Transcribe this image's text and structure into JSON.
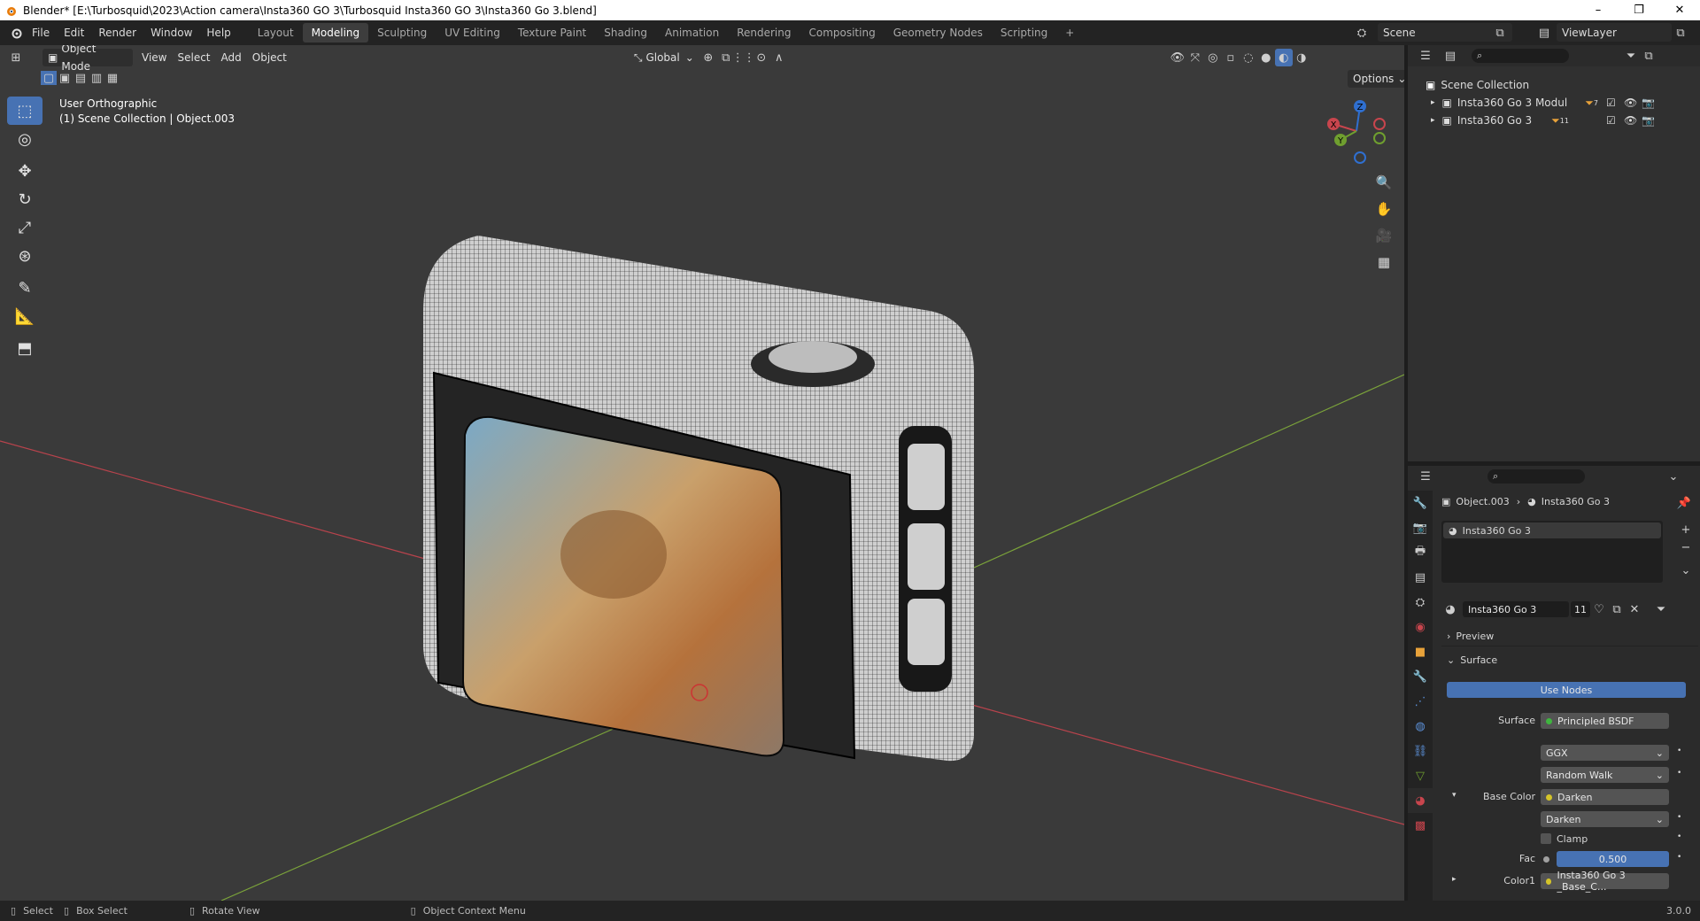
{
  "window": {
    "title": "Blender* [E:\\Turbosquid\\2023\\Action camera\\Insta360 GO 3\\Turbosquid Insta360 GO 3\\Insta360 Go 3.blend]",
    "minimize": "–",
    "restore": "❐",
    "close": "✕"
  },
  "menu": [
    "File",
    "Edit",
    "Render",
    "Window",
    "Help"
  ],
  "workspaces": [
    "Layout",
    "Modeling",
    "Sculpting",
    "UV Editing",
    "Texture Paint",
    "Shading",
    "Animation",
    "Rendering",
    "Compositing",
    "Geometry Nodes",
    "Scripting"
  ],
  "active_workspace": "Modeling",
  "add_workspace": "+",
  "scene": {
    "name": "Scene",
    "view_layer": "ViewLayer"
  },
  "viewport": {
    "mode": "Object Mode",
    "menus": [
      "View",
      "Select",
      "Add",
      "Object"
    ],
    "transform_orientation": "Global",
    "options_label": "Options",
    "view_name": "User Orthographic",
    "collection_info": "(1) Scene Collection | Object.003",
    "gizmo": {
      "x": "X",
      "y": "Y",
      "z": "Z"
    },
    "shading_mode": "solid-material-preview"
  },
  "tools": [
    "select-box",
    "cursor",
    "move",
    "rotate",
    "scale",
    "transform",
    "annotate",
    "measure",
    "add-cube"
  ],
  "outliner": {
    "root": "Scene Collection",
    "items": [
      {
        "name": "Insta360 Go 3 Modul",
        "badge": "7"
      },
      {
        "name": "Insta360 Go 3",
        "badge": "11"
      }
    ]
  },
  "properties": {
    "breadcrumb_object": "Object.003",
    "breadcrumb_material": "Insta360 Go 3",
    "slot_name": "Insta360 Go 3",
    "material_name": "Insta360 Go 3",
    "users": "11",
    "panels": {
      "preview": "Preview",
      "surface": "Surface"
    },
    "use_nodes": "Use Nodes",
    "surface_label": "Surface",
    "surface_value": "Principled BSDF",
    "distribution": "GGX",
    "subsurface_method": "Random Walk",
    "base_color_label": "Base Color",
    "base_color_value": "Darken",
    "blend_mode": "Darken",
    "clamp_label": "Clamp",
    "fac_label": "Fac",
    "fac_value": "0.500",
    "color1_label": "Color1",
    "color1_value": "Insta360 Go 3 _Base_C..."
  },
  "statusbar": {
    "select": "Select",
    "box_select": "Box Select",
    "rotate_view": "Rotate View",
    "context_menu": "Object Context Menu",
    "version": "3.0.0"
  },
  "colors": {
    "accent": "#4772b3",
    "viewport_bg": "#3a3a3a",
    "x_axis": "#c8454d",
    "y_axis": "#6f9f2f",
    "z_axis": "#2f6fd0"
  }
}
